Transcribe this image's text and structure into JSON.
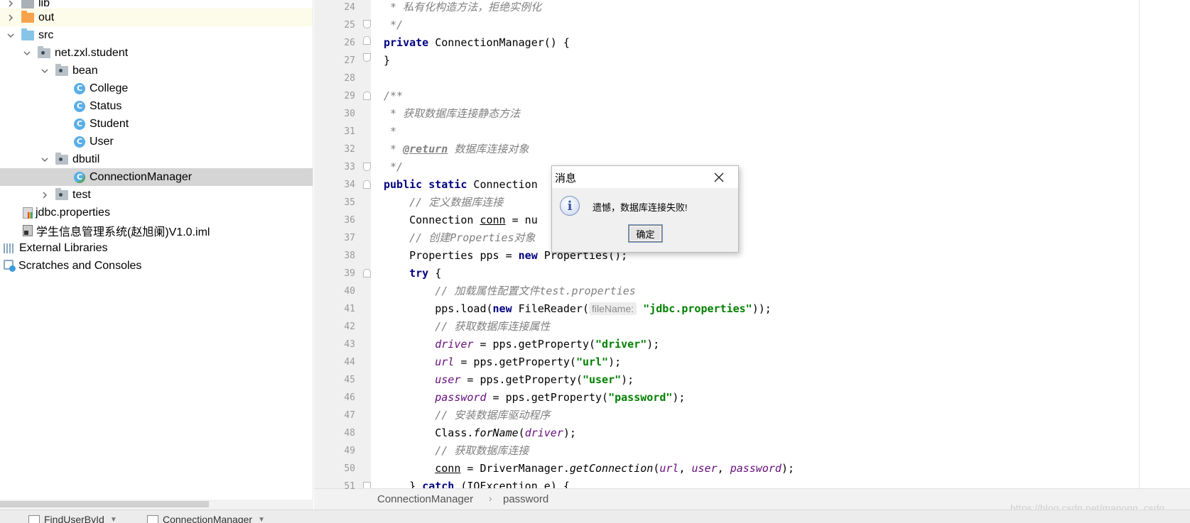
{
  "project_tree": {
    "items": [
      {
        "label": "lib"
      },
      {
        "label": "out"
      },
      {
        "label": "src"
      },
      {
        "label": "net.zxl.student"
      },
      {
        "label": "bean"
      },
      {
        "label": "College"
      },
      {
        "label": "Status"
      },
      {
        "label": "Student"
      },
      {
        "label": "User"
      },
      {
        "label": "dbutil"
      },
      {
        "label": "ConnectionManager"
      },
      {
        "label": "test"
      },
      {
        "label": "jdbc.properties"
      },
      {
        "label": "学生信息管理系统(赵旭阑)V1.0.iml"
      },
      {
        "label": "External Libraries"
      },
      {
        "label": "Scratches and Consoles"
      }
    ],
    "class_icon_letter": "C"
  },
  "editor": {
    "line_numbers": [
      "24",
      "25",
      "26",
      "27",
      "28",
      "29",
      "30",
      "31",
      "32",
      "33",
      "34",
      "35",
      "36",
      "37",
      "38",
      "39",
      "40",
      "41",
      "42",
      "43",
      "44",
      "45",
      "46",
      "47",
      "48",
      "49",
      "50",
      "51"
    ],
    "lines": {
      "l24": " * 私有化构造方法，拒绝实例化",
      "l25": " */",
      "l26a": "private",
      "l26b": " ConnectionManager() {",
      "l27": "}",
      "l29": "/**",
      "l30": " * 获取数据库连接静态方法",
      "l31": " *",
      "l32a": " * ",
      "l32b": "@return",
      "l32c": " 数据库连接对象",
      "l33": " */",
      "l34a": "public static",
      "l34b": " Connection",
      "l35": "    // 定义数据库连接",
      "l36a": "    Connection ",
      "l36b": "conn",
      "l36c": " = nu",
      "l37": "    // 创建Properties对象",
      "l38a": "    Properties pps = ",
      "l38b": "new",
      "l38c": " Properties();",
      "l39a": "    try",
      "l39b": " {",
      "l40": "        // 加载属性配置文件test.properties",
      "l41a": "        pps.load(",
      "l41b": "new",
      "l41c": " FileReader(",
      "l41hint": "fileName:",
      "l41d": "\"jdbc.properties\"",
      "l41e": "));",
      "l42": "        // 获取数据库连接属性",
      "l43a": "driver",
      "l43b": " = pps.getProperty(",
      "l43c": "\"driver\"",
      "l43d": ");",
      "l44a": "url",
      "l44b": " = pps.getProperty(",
      "l44c": "\"url\"",
      "l44d": ");",
      "l45a": "user",
      "l45b": " = pps.getProperty(",
      "l45c": "\"user\"",
      "l45d": ");",
      "l46a": "password",
      "l46b": " = pps.getProperty(",
      "l46c": "\"password\"",
      "l46d": ");",
      "l47": "        // 安装数据库驱动程序",
      "l48a": "        Class.",
      "l48b": "forName",
      "l48c": "(",
      "l48d": "driver",
      "l48e": ");",
      "l49": "        // 获取数据库连接",
      "l50a": "conn",
      "l50b": " = DriverManager.",
      "l50c": "getConnection",
      "l50d": "(",
      "l50e": "url",
      "l50f": ", ",
      "l50g": "user",
      "l50h": ", ",
      "l50i": "password",
      "l50j": ");",
      "l51a": "    } ",
      "l51b": "catch",
      "l51c": " (IOException e) {"
    }
  },
  "breadcrumb": {
    "items": [
      "ConnectionManager",
      "password"
    ],
    "separator": "›"
  },
  "watermark": "https://blog.csdn.net/manong_csdn",
  "bottom_tabs": {
    "items": [
      "FindUserById",
      "ConnectionManager"
    ]
  },
  "dialog": {
    "title": "消息",
    "message": "遗憾，数据库连接失败!",
    "ok_label": "确定",
    "info_glyph": "i"
  },
  "colors": {
    "keyword": "#000080",
    "string": "#008000",
    "comment": "#808080",
    "field": "#660e7a",
    "selection": "#d5d5d5"
  }
}
